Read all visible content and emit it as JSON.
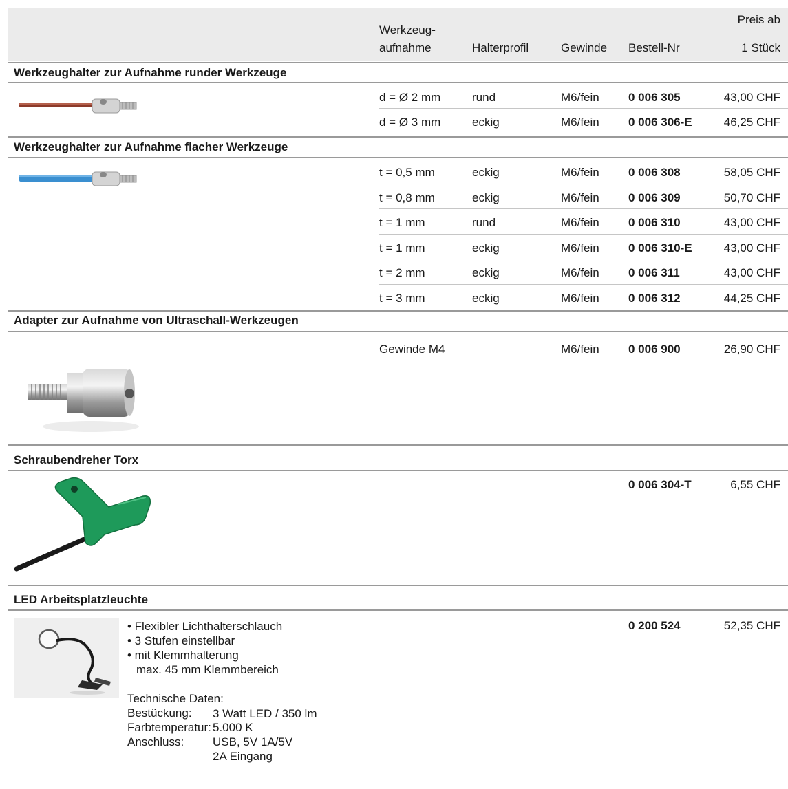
{
  "header": {
    "werkzeug_line1": "Werkzeug-",
    "werkzeug_line2": "aufnahme",
    "halterprofil": "Halterprofil",
    "gewinde": "Gewinde",
    "bestell": "Bestell-Nr",
    "preis_line1": "Preis ab",
    "preis_line2": "1 Stück"
  },
  "sections": [
    {
      "title": "Werkzeughalter zur Aufnahme runder Werkzeuge",
      "rows": [
        {
          "aufnahme": "d = Ø 2 mm",
          "profil": "rund",
          "gewinde": "M6/fein",
          "nr": "0 006 305",
          "preis": "43,00 CHF"
        },
        {
          "aufnahme": "d = Ø 3 mm",
          "profil": "eckig",
          "gewinde": "M6/fein",
          "nr": "0 006 306-E",
          "preis": "46,25 CHF"
        }
      ]
    },
    {
      "title": "Werkzeughalter zur Aufnahme flacher Werkzeuge",
      "rows": [
        {
          "aufnahme": "t = 0,5 mm",
          "profil": "eckig",
          "gewinde": "M6/fein",
          "nr": "0 006 308",
          "preis": "58,05 CHF"
        },
        {
          "aufnahme": "t = 0,8 mm",
          "profil": "eckig",
          "gewinde": "M6/fein",
          "nr": "0 006 309",
          "preis": "50,70 CHF"
        },
        {
          "aufnahme": "t = 1 mm",
          "profil": "rund",
          "gewinde": "M6/fein",
          "nr": "0 006 310",
          "preis": "43,00 CHF"
        },
        {
          "aufnahme": "t = 1 mm",
          "profil": "eckig",
          "gewinde": "M6/fein",
          "nr": "0 006 310-E",
          "preis": "43,00 CHF"
        },
        {
          "aufnahme": "t = 2 mm",
          "profil": "eckig",
          "gewinde": "M6/fein",
          "nr": "0 006 311",
          "preis": "43,00 CHF"
        },
        {
          "aufnahme": "t = 3 mm",
          "profil": "eckig",
          "gewinde": "M6/fein",
          "nr": "0 006 312",
          "preis": "44,25 CHF"
        }
      ]
    },
    {
      "title": "Adapter zur Aufnahme von Ultraschall-Werkzeugen",
      "rows": [
        {
          "aufnahme": "Gewinde M4",
          "profil": "",
          "gewinde": "M6/fein",
          "nr": "0 006 900",
          "preis": "26,90 CHF"
        }
      ]
    },
    {
      "title": "Schraubendreher Torx",
      "rows": [
        {
          "aufnahme": "",
          "profil": "",
          "gewinde": "",
          "nr": "0 006 304-T",
          "preis": "6,55 CHF"
        }
      ]
    },
    {
      "title": "LED Arbeitsplatzleuchte",
      "rows": [
        {
          "aufnahme": "",
          "profil": "",
          "gewinde": "",
          "nr": "0 200 524",
          "preis": "52,35 CHF"
        }
      ]
    }
  ],
  "led": {
    "bullet1": "• Flexibler Lichthalterschlauch",
    "bullet2": "• 3 Stufen einstellbar",
    "bullet3": "• mit Klemmhalterung",
    "bullet3_cont": "max. 45 mm Klemmbereich",
    "tech_title": "Technische Daten:",
    "spec1_label": "Bestückung:",
    "spec1_value": "3 Watt LED / 350 lm",
    "spec2_label": "Farbtemperatur:",
    "spec2_value": "5.000 K",
    "spec3_label": "Anschluss:",
    "spec3_value_line1": "USB, 5V 1A/5V",
    "spec3_value_line2": "2A Eingang"
  },
  "images": {
    "round_holder": "holder-round-tool-photo",
    "flat_holder": "holder-flat-tool-photo",
    "adapter": "ultrasonic-adapter-photo",
    "torx": "torx-screwdriver-photo",
    "lamp": "led-lamp-photo"
  },
  "colors": {
    "header_band": "#ebebeb",
    "rule_thick": "#9a9a9a",
    "rule_thin": "#c6c6c6",
    "round_tool_shaft": "#8b3a2a",
    "flat_tool_shaft": "#3a8fd0",
    "torx_handle": "#1e9a5a"
  }
}
